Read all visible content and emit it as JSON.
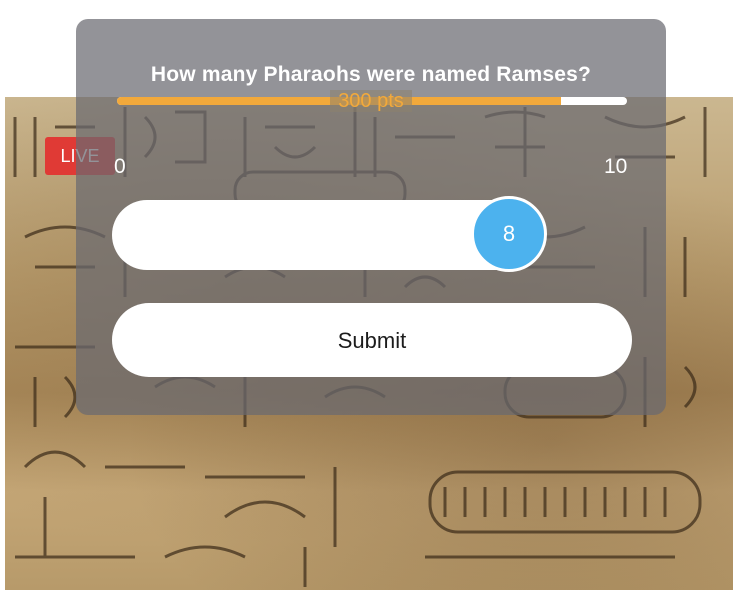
{
  "live_badge": "LIVE",
  "question": "How many Pharaohs were named Ramses?",
  "timer": {
    "remaining_fraction": 0.87
  },
  "points_label": "300 pts",
  "slider": {
    "min_label": "0",
    "max_label": "10",
    "value": "8"
  },
  "submit_label": "Submit",
  "colors": {
    "live": "#e03a35",
    "timer_fill": "#f2a93b",
    "slider_thumb": "#4cb2ee",
    "card_overlay": "#6a6a70"
  }
}
